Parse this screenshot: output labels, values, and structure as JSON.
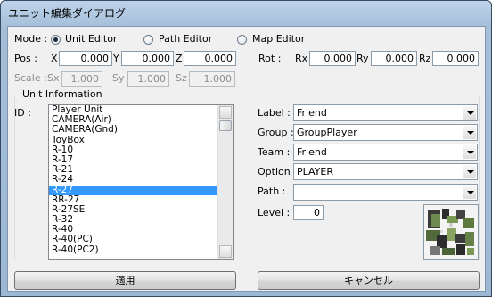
{
  "window": {
    "title": "ユニット編集ダイアログ"
  },
  "mode": {
    "label": "Mode :",
    "options": [
      {
        "label": "Unit Editor",
        "selected": true
      },
      {
        "label": "Path Editor",
        "selected": false
      },
      {
        "label": "Map Editor",
        "selected": false
      }
    ]
  },
  "pos": {
    "label": "Pos :",
    "x_label": "X",
    "y_label": "Y",
    "z_label": "Z",
    "x": "0.000",
    "y": "0.000",
    "z": "0.000"
  },
  "rot": {
    "label": "Rot :",
    "rx_label": "Rx",
    "ry_label": "Ry",
    "rz_label": "Rz",
    "rx": "0.000",
    "ry": "0.000",
    "rz": "0.000"
  },
  "scale": {
    "label": "Scale :",
    "sx_label": "Sx",
    "sy_label": "Sy",
    "sz_label": "Sz",
    "sx": "1.000",
    "sy": "1.000",
    "sz": "1.000"
  },
  "unit_info": {
    "title": "Unit Information",
    "id_label": "ID :",
    "items": [
      "Player Unit",
      "CAMERA(Air)",
      "CAMERA(Gnd)",
      "ToyBox",
      "R-10",
      "R-17",
      "R-21",
      "R-24",
      "R-27",
      "RR-27",
      "R-27SE",
      "R-32",
      "R-40",
      "R-40(PC)",
      "R-40(PC2)"
    ],
    "selected_index": 8
  },
  "properties": {
    "label_label": "Label :",
    "label_value": "Friend",
    "group_label": "Group :",
    "group_value": "GroupPlayer",
    "team_label": "Team :",
    "team_value": "Friend",
    "option_label": "Option :",
    "option_value": "PLAYER",
    "path_label": "Path :",
    "path_value": "",
    "level_label": "Level :",
    "level_value": "0"
  },
  "buttons": {
    "apply": "適用",
    "cancel": "キャンセル"
  },
  "colors": {
    "selection": "#3399ff",
    "title_gradient_top": "#bdd3ea",
    "dialog_bg": "#f0f0f0"
  }
}
